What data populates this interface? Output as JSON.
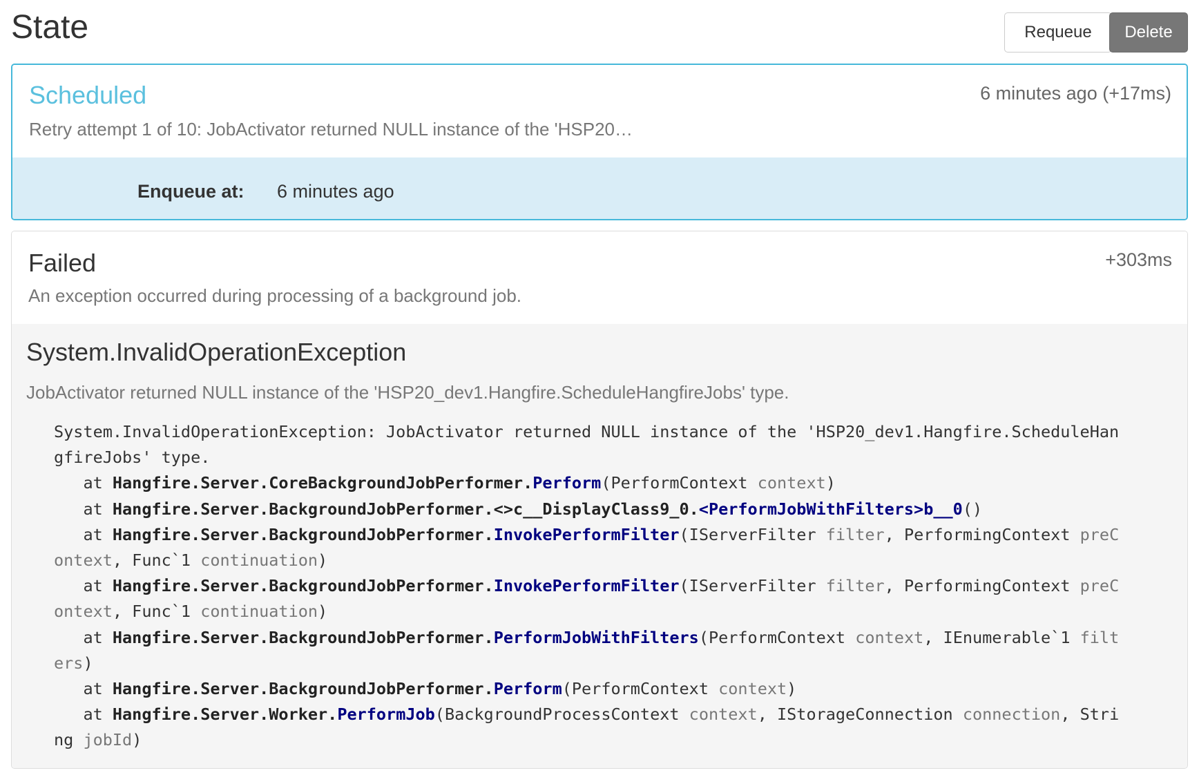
{
  "header": {
    "title": "State",
    "requeue_label": "Requeue",
    "delete_label": "Delete"
  },
  "states": {
    "scheduled": {
      "name": "Scheduled",
      "time": "6 minutes ago (+17ms)",
      "reason": "Retry attempt 1 of 10: JobActivator returned NULL instance of the 'HSP20…",
      "enqueue_label": "Enqueue at:",
      "enqueue_value": "6 minutes ago"
    },
    "failed": {
      "name": "Failed",
      "time": "+303ms",
      "reason": "An exception occurred during processing of a background job.",
      "exception_type": "System.InvalidOperationException",
      "exception_message": "JobActivator returned NULL instance of the 'HSP20_dev1.Hangfire.ScheduleHangfireJobs' type.",
      "stack_line1": "System.InvalidOperationException: JobActivator returned NULL instance of the 'HSP20_dev1.Hangfire.ScheduleHan",
      "stack_line2": "gfireJobs' type.",
      "frames": [
        {
          "at": "   at ",
          "type": "Hangfire.Server.CoreBackgroundJobPerformer",
          "dot": ".",
          "method": "Perform",
          "open": "(",
          "args": [
            [
              "PerformContext",
              "context"
            ]
          ],
          "close": ")",
          "wrap": ""
        },
        {
          "at": "   at ",
          "type": "Hangfire.Server.BackgroundJobPerformer.<>c__DisplayClass9_0",
          "dot": ".",
          "method": "<PerformJobWithFilters>b__0",
          "open": "(",
          "args": [],
          "close": ")",
          "wrap": ""
        },
        {
          "at": "   at ",
          "type": "Hangfire.Server.BackgroundJobPerformer",
          "dot": ".",
          "method": "InvokePerformFilter",
          "open": "(",
          "args": [
            [
              "IServerFilter",
              "filter"
            ],
            [
              "PerformingContext",
              "preC"
            ]
          ],
          "close": "",
          "wrap": "ontext, Func`1 continuation)"
        },
        {
          "at": "   at ",
          "type": "Hangfire.Server.BackgroundJobPerformer",
          "dot": ".",
          "method": "InvokePerformFilter",
          "open": "(",
          "args": [
            [
              "IServerFilter",
              "filter"
            ],
            [
              "PerformingContext",
              "preC"
            ]
          ],
          "close": "",
          "wrap": "ontext, Func`1 continuation)"
        },
        {
          "at": "   at ",
          "type": "Hangfire.Server.BackgroundJobPerformer",
          "dot": ".",
          "method": "PerformJobWithFilters",
          "open": "(",
          "args": [
            [
              "PerformContext",
              "context"
            ],
            [
              "IEnumerable`1",
              "filt"
            ]
          ],
          "close": "",
          "wrap": "ers)"
        },
        {
          "at": "   at ",
          "type": "Hangfire.Server.BackgroundJobPerformer",
          "dot": ".",
          "method": "Perform",
          "open": "(",
          "args": [
            [
              "PerformContext",
              "context"
            ]
          ],
          "close": ")",
          "wrap": ""
        },
        {
          "at": "   at ",
          "type": "Hangfire.Server.Worker",
          "dot": ".",
          "method": "PerformJob",
          "open": "(",
          "args": [
            [
              "BackgroundProcessContext",
              "context"
            ],
            [
              "IStorageConnection",
              "connection"
            ],
            [
              "Stri",
              ""
            ]
          ],
          "close": "",
          "wrap": "ng jobId)"
        }
      ]
    }
  }
}
